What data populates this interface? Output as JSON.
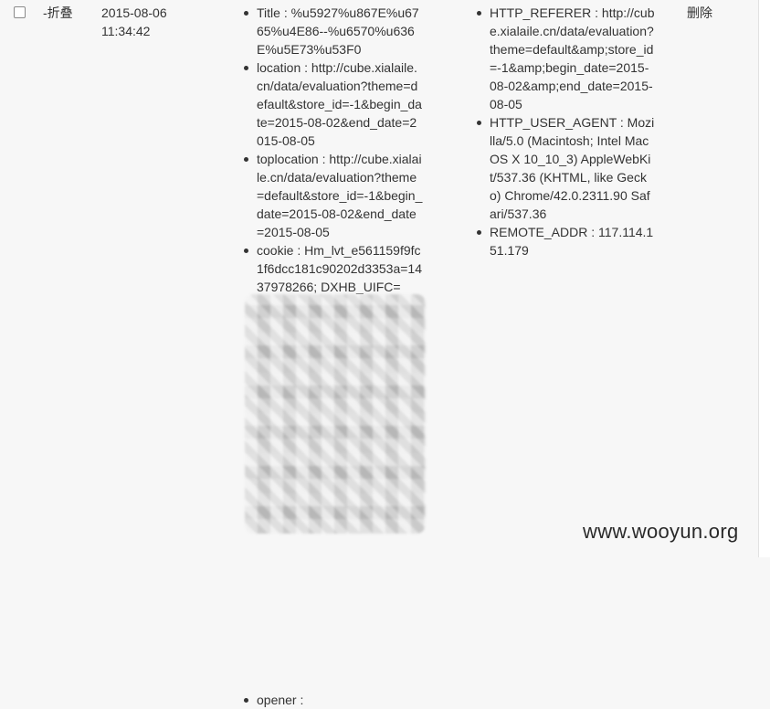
{
  "row": {
    "toggle_label": "-折叠",
    "date": "2015-08-06",
    "time": "11:34:42",
    "delete_label": "删除"
  },
  "request_fields": [
    {
      "text": "Title : %u5927%u867E%u6765%u4E86--%u6570%u636E%u5E73%u53F0"
    },
    {
      "text": "location : http://cube.xialaile.cn/data/evaluation?theme=default&store_id=-1&begin_date=2015-08-02&end_date=2015-08-05"
    },
    {
      "text": "toplocation : http://cube.xialaile.cn/data/evaluation?theme=default&store_id=-1&begin_date=2015-08-02&end_date=2015-08-05"
    },
    {
      "text": "cookie : Hm_lvt_e561159f9fc1f6dcc181c90202d3353a=1437978266; DXHB_UIFC="
    },
    {
      "text": "opener :"
    }
  ],
  "server_fields": [
    {
      "text": "HTTP_REFERER : http://cube.xialaile.cn/data/evaluation?theme=default&amp;store_id=-1&amp;begin_date=2015-08-02&amp;end_date=2015-08-05"
    },
    {
      "text": "HTTP_USER_AGENT : Mozilla/5.0 (Macintosh; Intel Mac OS X 10_10_3) AppleWebKit/537.36 (KHTML, like Gecko) Chrome/42.0.2311.90 Safari/537.36"
    },
    {
      "text": "REMOTE_ADDR : 117.114.151.179"
    }
  ],
  "watermark": "www.wooyun.org"
}
